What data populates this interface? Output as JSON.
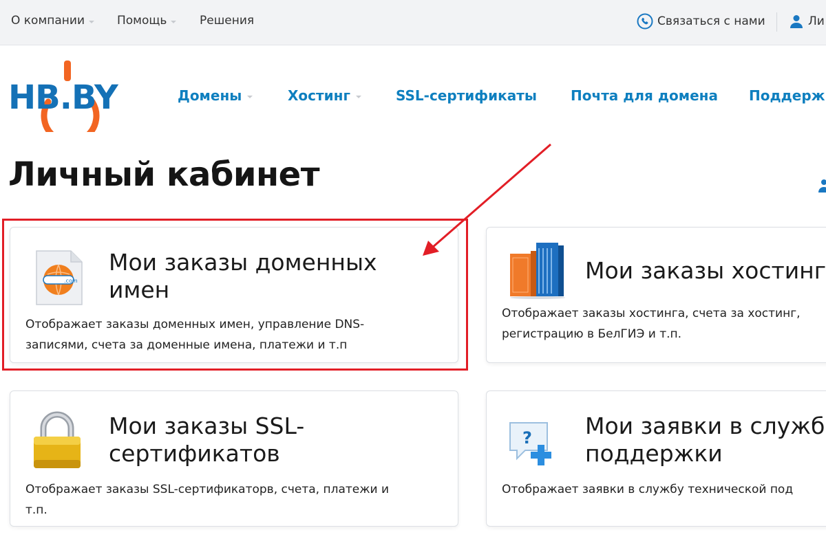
{
  "topbar": {
    "about": "О компании",
    "help": "Помощь",
    "solutions": "Решения",
    "contact": "Связаться с нами",
    "account": "Ли"
  },
  "logo": {
    "text": "HB.BY"
  },
  "nav": {
    "items": [
      {
        "label": "Домены",
        "has_dropdown": true
      },
      {
        "label": "Хостинг",
        "has_dropdown": true
      },
      {
        "label": "SSL-сертификаты",
        "has_dropdown": false
      },
      {
        "label": "Почта для домена",
        "has_dropdown": false
      },
      {
        "label": "Поддерж",
        "has_dropdown": false
      }
    ]
  },
  "page": {
    "title": "Личный кабинет"
  },
  "cards": [
    {
      "title_line1": "Мои заказы доменных",
      "title_line2": "имен",
      "desc_line1": "Отображает заказы доменных имен, управление DNS-",
      "desc_line2": "записями, счета за доменные имена, платежи и т.п",
      "icon": "domain-document-icon",
      "icon_text": ".com"
    },
    {
      "title_line1": "Мои заказы хостинг",
      "desc_line1": "Отображает заказы хостинга, счета за хостинг,",
      "desc_line2": "регистрацию в БелГИЭ и т.п.",
      "icon": "server-rack-icon"
    },
    {
      "title_line1": "Мои заказы SSL-",
      "title_line2": "сертификатов",
      "desc_line1": "Отображает заказы SSL-сертификаторв, счета, платежи и",
      "desc_line2": "т.п.",
      "icon": "padlock-icon"
    },
    {
      "title_line1": "Мои заявки в служб",
      "title_line2": "поддержки",
      "desc_line1": "Отображает заявки в службу технической под",
      "icon": "support-request-icon",
      "icon_text": "?"
    }
  ],
  "colors": {
    "nav_blue": "#0e7fbf",
    "logo_orange": "#f26522",
    "highlight_red": "#e21e26",
    "topbar_bg": "#f2f3f5"
  }
}
